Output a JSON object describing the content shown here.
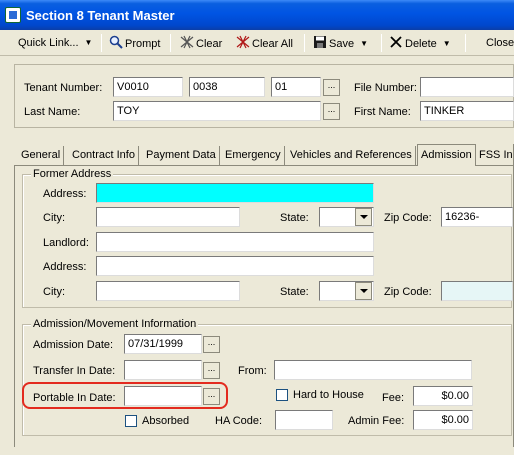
{
  "window": {
    "title": "Section 8 Tenant Master"
  },
  "toolbar": {
    "quick_link": "Quick Link...",
    "prompt": "Prompt",
    "clear": "Clear",
    "clear_all": "Clear All",
    "save": "Save",
    "delete": "Delete",
    "close": "Close"
  },
  "header": {
    "tenant_number_label": "Tenant Number:",
    "tenant_number_1": "V0010",
    "tenant_number_2": "0038",
    "tenant_number_3": "01",
    "file_number_label": "File Number:",
    "file_number": "",
    "last_name_label": "Last Name:",
    "last_name": "TOY",
    "first_name_label": "First Name:",
    "first_name": "TINKER",
    "ellipsis": "..."
  },
  "tabs": [
    {
      "label": "General"
    },
    {
      "label": "Contract Info"
    },
    {
      "label": "Payment Data"
    },
    {
      "label": "Emergency"
    },
    {
      "label": "Vehicles and References"
    },
    {
      "label": "Admission"
    },
    {
      "label": "FSS In"
    }
  ],
  "former_address": {
    "group_title": "Former Address",
    "address_label": "Address:",
    "address": "",
    "city_label": "City:",
    "city": "",
    "state_label": "State:",
    "state": "",
    "zip_label": "Zip Code:",
    "zip": "16236-",
    "landlord_label": "Landlord:",
    "landlord": "",
    "address2_label": "Address:",
    "address2": "",
    "city2_label": "City:",
    "city2": "",
    "state2_label": "State:",
    "state2": "",
    "zip2_label": "Zip Code:",
    "zip2": ""
  },
  "admission": {
    "group_title": "Admission/Movement Information",
    "admission_date_label": "Admission Date:",
    "admission_date": "07/31/1999",
    "transfer_in_label": "Transfer In Date:",
    "transfer_in": "",
    "from_label": "From:",
    "from": "",
    "portable_in_label": "Portable In Date:",
    "portable_in": "",
    "hard_to_house_label": "Hard to House",
    "fee_label": "Fee:",
    "fee": "$0.00",
    "absorbed_label": "Absorbed",
    "ha_code_label": "HA Code:",
    "ha_code": "",
    "admin_fee_label": "Admin Fee:",
    "admin_fee": "$0.00"
  },
  "colors": {
    "title_bar": "#0054e3",
    "highlight": "#e32b1f",
    "cyan_field": "#00ffff"
  }
}
